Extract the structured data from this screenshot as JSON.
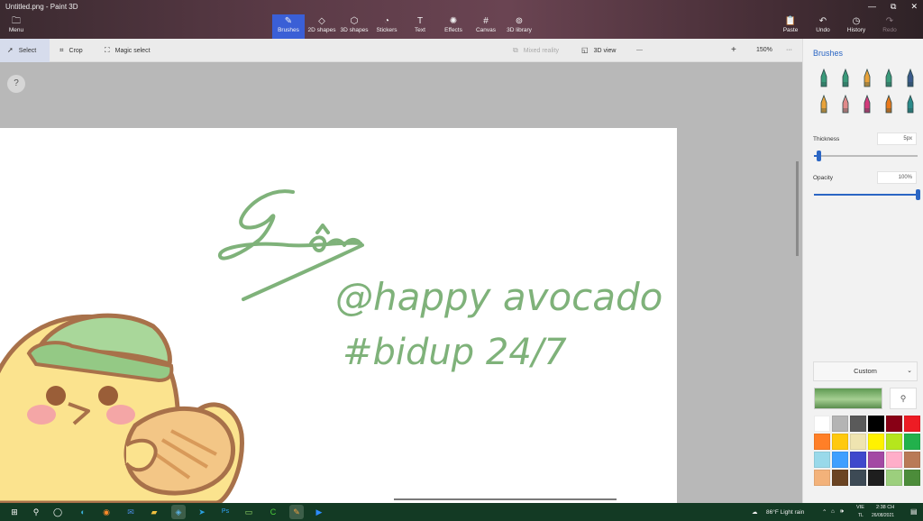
{
  "window": {
    "title": "Untitled.png - Paint 3D",
    "controls": [
      "—",
      "⧉",
      "✕"
    ]
  },
  "ribbon": {
    "menu": {
      "label": "Menu",
      "icon": "folder-icon"
    },
    "tools": [
      {
        "label": "Brushes",
        "icon": "brush-icon",
        "active": true
      },
      {
        "label": "2D shapes",
        "icon": "2d-shapes-icon"
      },
      {
        "label": "3D shapes",
        "icon": "3d-shapes-icon"
      },
      {
        "label": "Stickers",
        "icon": "stickers-icon"
      },
      {
        "label": "Text",
        "icon": "text-icon"
      },
      {
        "label": "Effects",
        "icon": "effects-icon"
      },
      {
        "label": "Canvas",
        "icon": "canvas-icon"
      },
      {
        "label": "3D library",
        "icon": "3d-library-icon"
      }
    ],
    "right": [
      {
        "label": "Paste",
        "icon": "paste-icon"
      },
      {
        "label": "Undo",
        "icon": "undo-icon"
      },
      {
        "label": "History",
        "icon": "history-icon"
      },
      {
        "label": "Redo",
        "icon": "redo-icon",
        "disabled": true
      }
    ]
  },
  "toolbar": {
    "select": "Select",
    "crop": "Crop",
    "magic_select": "Magic select",
    "mixed_reality": "Mixed reality",
    "view_3d": "3D view",
    "zoom_minus": "—",
    "zoom_plus": "+",
    "zoom_level": "150%",
    "zoom_fraction": 0.42,
    "more": "···"
  },
  "canvas": {
    "help": "?",
    "handwriting": [
      "@happy avocado",
      "#bidup 24/7"
    ],
    "ink_color": "#7fb27a"
  },
  "panel": {
    "title": "Brushes",
    "brushes": [
      {
        "name": "marker",
        "color": "#3a9a7a"
      },
      {
        "name": "calligraphy-pen",
        "color": "#3a9a7a"
      },
      {
        "name": "oil-brush",
        "color": "#e8a23a"
      },
      {
        "name": "watercolor",
        "color": "#3a9a7a"
      },
      {
        "name": "pixel-pen",
        "color": "#3a5a8a"
      },
      {
        "name": "pencil",
        "color": "#e8a23a"
      },
      {
        "name": "eraser",
        "color": "#e08a8a"
      },
      {
        "name": "crayon",
        "color": "#d23a7a"
      },
      {
        "name": "spray-can",
        "color": "#e8781a"
      },
      {
        "name": "fill",
        "color": "#2a8a8a"
      }
    ],
    "thickness": {
      "label": "Thickness",
      "value": "5px",
      "fraction": 0.05
    },
    "opacity": {
      "label": "Opacity",
      "value": "100%",
      "fraction": 1.0
    },
    "color_mode": "Custom",
    "current_color": "#7fb27a",
    "palette": [
      "#ffffff",
      "#b4b4b4",
      "#5a5a5a",
      "#000000",
      "#880015",
      "#ed1c24",
      "#ff7f27",
      "#ffc90e",
      "#efe4b0",
      "#fff200",
      "#b5e61d",
      "#22b14c",
      "#99d9ea",
      "#3f9fff",
      "#3f48cc",
      "#a349a4",
      "#ffaec9",
      "#b97a57",
      "#f3b27a",
      "#6b4423",
      "#3d4a55",
      "#1e1e1e",
      "#9ccf7d",
      "#4c8c3a"
    ]
  },
  "taskbar": {
    "apps": [
      "start-icon",
      "search-icon",
      "task-view-icon",
      "edge-icon",
      "firefox-icon",
      "mail-icon",
      "explorer-icon",
      "paint3d-icon",
      "telegram-icon",
      "photoshop-icon",
      "notepad-icon",
      "camtasia-icon",
      "paint-icon",
      "zoom-icon"
    ],
    "weather": "86°F Light rain",
    "lang": "VIE",
    "lang_sub": "TL",
    "time": "2:38 CH",
    "date": "26/08/2021"
  }
}
